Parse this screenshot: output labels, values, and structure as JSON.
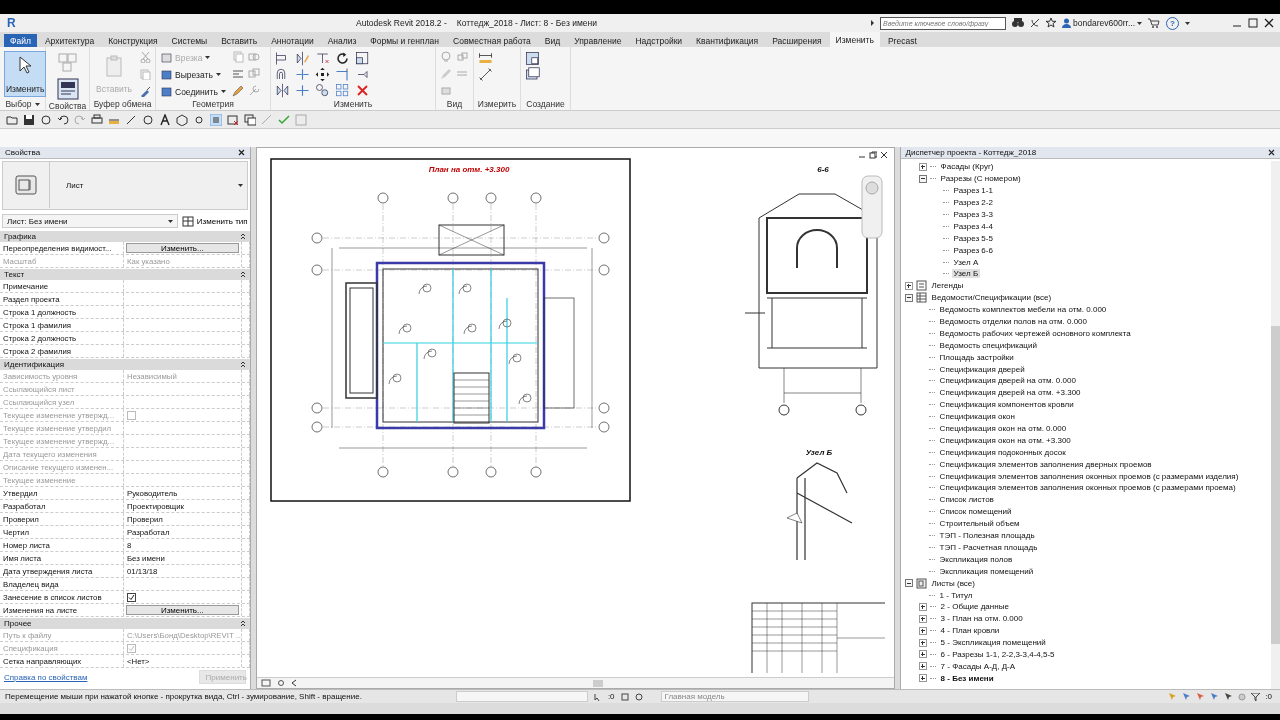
{
  "title_bar": {
    "logo": "R",
    "app": "Autodesk Revit 2018.2 -",
    "document": "Коттедж_2018 - Лист: 8 - Без имени",
    "search_placeholder": "Введите ключевое слово/фразу",
    "user": "bondarev600rr...",
    "help": "?"
  },
  "ribbon_tabs": [
    {
      "label": "Файл",
      "kind": "file",
      "selected": false
    },
    {
      "label": "Архитектура",
      "kind": "tab",
      "selected": false
    },
    {
      "label": "Конструкция",
      "kind": "tab",
      "selected": false
    },
    {
      "label": "Системы",
      "kind": "tab",
      "selected": false
    },
    {
      "label": "Вставить",
      "kind": "tab",
      "selected": false
    },
    {
      "label": "Аннотации",
      "kind": "tab",
      "selected": false
    },
    {
      "label": "Анализ",
      "kind": "tab",
      "selected": false
    },
    {
      "label": "Формы и генплан",
      "kind": "tab",
      "selected": false
    },
    {
      "label": "Совместная работа",
      "kind": "tab",
      "selected": false
    },
    {
      "label": "Вид",
      "kind": "tab",
      "selected": false
    },
    {
      "label": "Управление",
      "kind": "tab",
      "selected": false
    },
    {
      "label": "Надстройки",
      "kind": "tab",
      "selected": false
    },
    {
      "label": "Квантификация",
      "kind": "tab",
      "selected": false
    },
    {
      "label": "Расширения",
      "kind": "tab",
      "selected": false
    },
    {
      "label": "Изменить",
      "kind": "tab",
      "selected": true
    },
    {
      "label": "Precast",
      "kind": "tab",
      "selected": false
    }
  ],
  "ribbon_panels": [
    {
      "title": "Выбор",
      "tools": [
        {
          "label": "Изменить",
          "kind": "large",
          "selected": true,
          "disabled": false
        }
      ]
    },
    {
      "title": "Свойства"
    },
    {
      "title": "Буфер обмена",
      "tools": [
        {
          "label": "Вставить",
          "kind": "large",
          "selected": false,
          "disabled": true
        }
      ]
    },
    {
      "title": "Геометрия",
      "tools": [
        {
          "label": "Врезка",
          "kind": "small",
          "disabled": true
        },
        {
          "label": "Вырезать",
          "kind": "small",
          "disabled": false
        },
        {
          "label": "Соединить",
          "kind": "small",
          "disabled": false
        }
      ]
    },
    {
      "title": "Изменить"
    },
    {
      "title": "Вид"
    },
    {
      "title": "Измерить"
    },
    {
      "title": "Создание"
    }
  ],
  "properties": {
    "title": "Свойства",
    "type_name": "Лист",
    "instance": "Лист: Без имени",
    "edit_type": "Изменить тип",
    "groups": [
      {
        "name": "Графика",
        "rows": [
          {
            "label": "Переопределения видимост...",
            "kind": "button",
            "value": "Изменить...",
            "disabled": false
          },
          {
            "label": "Масштаб",
            "kind": "text",
            "value": "Как указано",
            "disabled": true
          }
        ]
      },
      {
        "name": "Текст",
        "rows": [
          {
            "label": "Примечание",
            "kind": "text",
            "disabled": false
          },
          {
            "label": "Раздел проекта",
            "kind": "text",
            "disabled": false
          },
          {
            "label": "Строка 1 должность",
            "kind": "text",
            "disabled": false
          },
          {
            "label": "Строка 1 фамилия",
            "kind": "text",
            "disabled": false
          },
          {
            "label": "Строка 2 должность",
            "kind": "text",
            "disabled": false
          },
          {
            "label": "Строка 2 фамилия",
            "kind": "text",
            "disabled": false
          }
        ]
      },
      {
        "name": "Идентификация",
        "rows": [
          {
            "label": "Зависимость уровня",
            "kind": "text",
            "value": "Независимый",
            "disabled": true
          },
          {
            "label": "Ссылающийся лист",
            "kind": "text",
            "disabled": true
          },
          {
            "label": "Ссылающийся узел",
            "kind": "text",
            "disabled": true
          },
          {
            "label": "Текущее изменение утвержд...",
            "kind": "checkbox",
            "checked": false,
            "disabled": true
          },
          {
            "label": "Текущее изменение утвердил",
            "kind": "text",
            "disabled": true
          },
          {
            "label": "Текущее изменение утвержд...",
            "kind": "text",
            "disabled": true
          },
          {
            "label": "Дата текущего изменения",
            "kind": "text",
            "disabled": true
          },
          {
            "label": "Описание текущего изменен...",
            "kind": "text",
            "disabled": true
          },
          {
            "label": "Текущее изменение",
            "kind": "text",
            "disabled": true
          },
          {
            "label": "Утвердил",
            "kind": "text",
            "value": "Руководитель",
            "disabled": false
          },
          {
            "label": "Разработал",
            "kind": "text",
            "value": "Проектировщик",
            "disabled": false
          },
          {
            "label": "Проверил",
            "kind": "text",
            "value": "Проверил",
            "disabled": false
          },
          {
            "label": "Чертил",
            "kind": "text",
            "value": "Разработал",
            "disabled": false
          },
          {
            "label": "Номер листа",
            "kind": "text",
            "value": "8",
            "disabled": false
          },
          {
            "label": "Имя листа",
            "kind": "text",
            "value": "Без имени",
            "disabled": false
          },
          {
            "label": "Дата утверждения листа",
            "kind": "text",
            "value": "01/13/18",
            "disabled": false
          },
          {
            "label": "Владелец вида",
            "kind": "text",
            "disabled": false
          },
          {
            "label": "Занесение в список листов",
            "kind": "checkbox",
            "checked": true,
            "disabled": false
          },
          {
            "label": "Изменения на листе",
            "kind": "button",
            "value": "Изменить...",
            "disabled": false
          }
        ]
      },
      {
        "name": "Прочее",
        "rows": [
          {
            "label": "Путь к файлу",
            "kind": "text",
            "value": "C:\\Users\\Бонд\\Desktop\\REVIT ...",
            "disabled": true
          },
          {
            "label": "Спецификация",
            "kind": "checkbox",
            "checked": true,
            "disabled": true
          },
          {
            "label": "Сетка направляющих",
            "kind": "text",
            "value": "<Нет>",
            "disabled": false
          }
        ]
      }
    ],
    "help_link": "Справка по свойствам",
    "apply": {
      "label": "Применить",
      "disabled": true
    }
  },
  "view": {
    "sheet_title": "План на отм. +3.300",
    "section_title": "6-6",
    "detail_title": "Узел Б"
  },
  "browser": {
    "title": "Диспетчер проекта - Коттедж_2018",
    "continued": [
      {
        "label": "Фасады (Круг)",
        "expanded": false,
        "selected": false
      },
      {
        "label": "Разрезы (С номером)",
        "expanded": true,
        "selected": false,
        "children": [
          {
            "label": "Разрез 1-1",
            "selected": false
          },
          {
            "label": "Разрез 2-2",
            "selected": false
          },
          {
            "label": "Разрез 3-3",
            "selected": false
          },
          {
            "label": "Разрез 4-4",
            "selected": false
          },
          {
            "label": "Разрез 5-5",
            "selected": false
          },
          {
            "label": "Разрез 6-6",
            "selected": false
          },
          {
            "label": "Узел А",
            "selected": false
          },
          {
            "label": "Узел Б",
            "selected": true
          }
        ]
      }
    ],
    "tree": [
      {
        "label": "Легенды",
        "expanded": false,
        "selected": false
      },
      {
        "label": "Ведомости/Спецификации (все)",
        "expanded": true,
        "selected": false,
        "children": [
          {
            "label": "Ведомость комплектов мебели на отм. 0.000",
            "selected": false
          },
          {
            "label": "Ведомость отделки полов на отм. 0.000",
            "selected": false
          },
          {
            "label": "Ведомость рабочих чертежей основного комплекта",
            "selected": false
          },
          {
            "label": "Ведомость спецификаций",
            "selected": false
          },
          {
            "label": "Площадь застройки",
            "selected": false
          },
          {
            "label": "Спецификация дверей",
            "selected": false
          },
          {
            "label": "Спецификация дверей на отм. 0.000",
            "selected": false
          },
          {
            "label": "Спецификация дверей на отм. +3.300",
            "selected": false
          },
          {
            "label": "Спецификация компонентов кровли",
            "selected": false
          },
          {
            "label": "Спецификация окон",
            "selected": false
          },
          {
            "label": "Спецификация окон на отм. 0.000",
            "selected": false
          },
          {
            "label": "Спецификация окон на отм. +3.300",
            "selected": false
          },
          {
            "label": "Спецификация подоконных досок",
            "selected": false
          },
          {
            "label": "Спецификация элементов заполнения дверных проемов",
            "selected": false
          },
          {
            "label": "Спецификация элементов заполнения оконных проемов (с размерами изделия)",
            "selected": false
          },
          {
            "label": "Спецификация элементов заполнения оконных проемов (с размерами проема)",
            "selected": false
          },
          {
            "label": "Список листов",
            "selected": false
          },
          {
            "label": "Список помещений",
            "selected": false
          },
          {
            "label": "Строительный объем",
            "selected": false
          },
          {
            "label": "ТЭП - Полезная площадь",
            "selected": false
          },
          {
            "label": "ТЭП - Расчетная площадь",
            "selected": false
          },
          {
            "label": "Экспликация полов",
            "selected": false
          },
          {
            "label": "Экспликация помещений",
            "selected": false
          }
        ]
      },
      {
        "label": "Листы (все)",
        "expanded": true,
        "selected": false,
        "children": [
          {
            "label": "1 - Титул",
            "selected": false,
            "current": false
          },
          {
            "label": "2 - Общие данные",
            "expanded": false,
            "selected": false,
            "current": false
          },
          {
            "label": "3 - План на отм. 0.000",
            "expanded": false,
            "selected": false,
            "current": false
          },
          {
            "label": "4 - План кровли",
            "expanded": false,
            "selected": false,
            "current": false
          },
          {
            "label": "5 - Экспликация помещений",
            "expanded": false,
            "selected": false,
            "current": false
          },
          {
            "label": "6 - Разрезы 1-1, 2-2,3-3,4-4,5-5",
            "expanded": false,
            "selected": false,
            "current": false
          },
          {
            "label": "7 - Фасады А-Д, Д-А",
            "expanded": false,
            "selected": false,
            "current": false
          },
          {
            "label": "8 - Без имени",
            "expanded": false,
            "selected": false,
            "current": true
          }
        ]
      }
    ]
  },
  "status_bar": {
    "hint": "Перемещение мыши при нажатой кнопке - прокрутка вида, Ctrl - зумирование, Shift - вращение.",
    "selection_count": ":0",
    "workset": "Главная модель",
    "filter_count": ":0"
  }
}
